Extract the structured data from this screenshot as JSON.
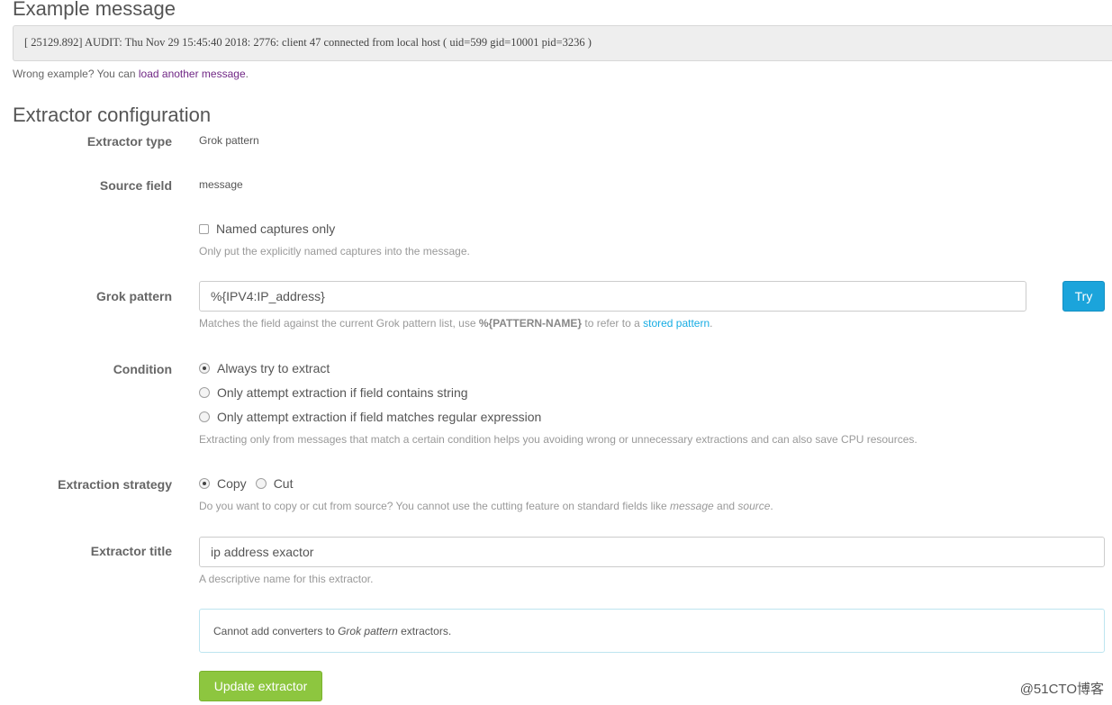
{
  "example": {
    "heading": "Example message",
    "message": "[ 25129.892] AUDIT: Thu Nov 29 15:45:40 2018: 2776: client 47 connected from local host ( uid=599 gid=10001 pid=3236 )",
    "wrong_prefix": "Wrong example? You can ",
    "wrong_link": "load another message",
    "wrong_suffix": "."
  },
  "config": {
    "heading": "Extractor configuration",
    "extractor_type": {
      "label": "Extractor type",
      "value": "Grok pattern"
    },
    "source_field": {
      "label": "Source field",
      "value": "message"
    },
    "named_captures": {
      "label": "Named captures only",
      "checked": false,
      "help": "Only put the explicitly named captures into the message."
    },
    "grok_pattern": {
      "label": "Grok pattern",
      "value": "%{IPV4:IP_address}",
      "try_label": "Try",
      "help_prefix": "Matches the field against the current Grok pattern list, use ",
      "help_bold": "%{PATTERN-NAME}",
      "help_middle": " to refer to a ",
      "help_link": "stored pattern",
      "help_suffix": "."
    },
    "condition": {
      "label": "Condition",
      "options": [
        "Always try to extract",
        "Only attempt extraction if field contains string",
        "Only attempt extraction if field matches regular expression"
      ],
      "selected": 0,
      "help": "Extracting only from messages that match a certain condition helps you avoiding wrong or unnecessary extractions and can also save CPU resources."
    },
    "strategy": {
      "label": "Extraction strategy",
      "options": [
        "Copy",
        "Cut"
      ],
      "selected": 0,
      "help_prefix": "Do you want to copy or cut from source? You cannot use the cutting feature on standard fields like ",
      "help_em1": "message",
      "help_and": " and ",
      "help_em2": "source",
      "help_suffix": "."
    },
    "title": {
      "label": "Extractor title",
      "value": "ip address exactor",
      "help": "A descriptive name for this extractor."
    },
    "converters": {
      "prefix": "Cannot add converters to ",
      "em": "Grok pattern",
      "suffix": " extractors."
    },
    "update_label": "Update extractor"
  },
  "watermark": "@51CTO博客",
  "colors": {
    "try_button": "#1ba4db",
    "update_button": "#8dc63f",
    "link_purple": "#702785",
    "link_blue": "#16ace3"
  }
}
